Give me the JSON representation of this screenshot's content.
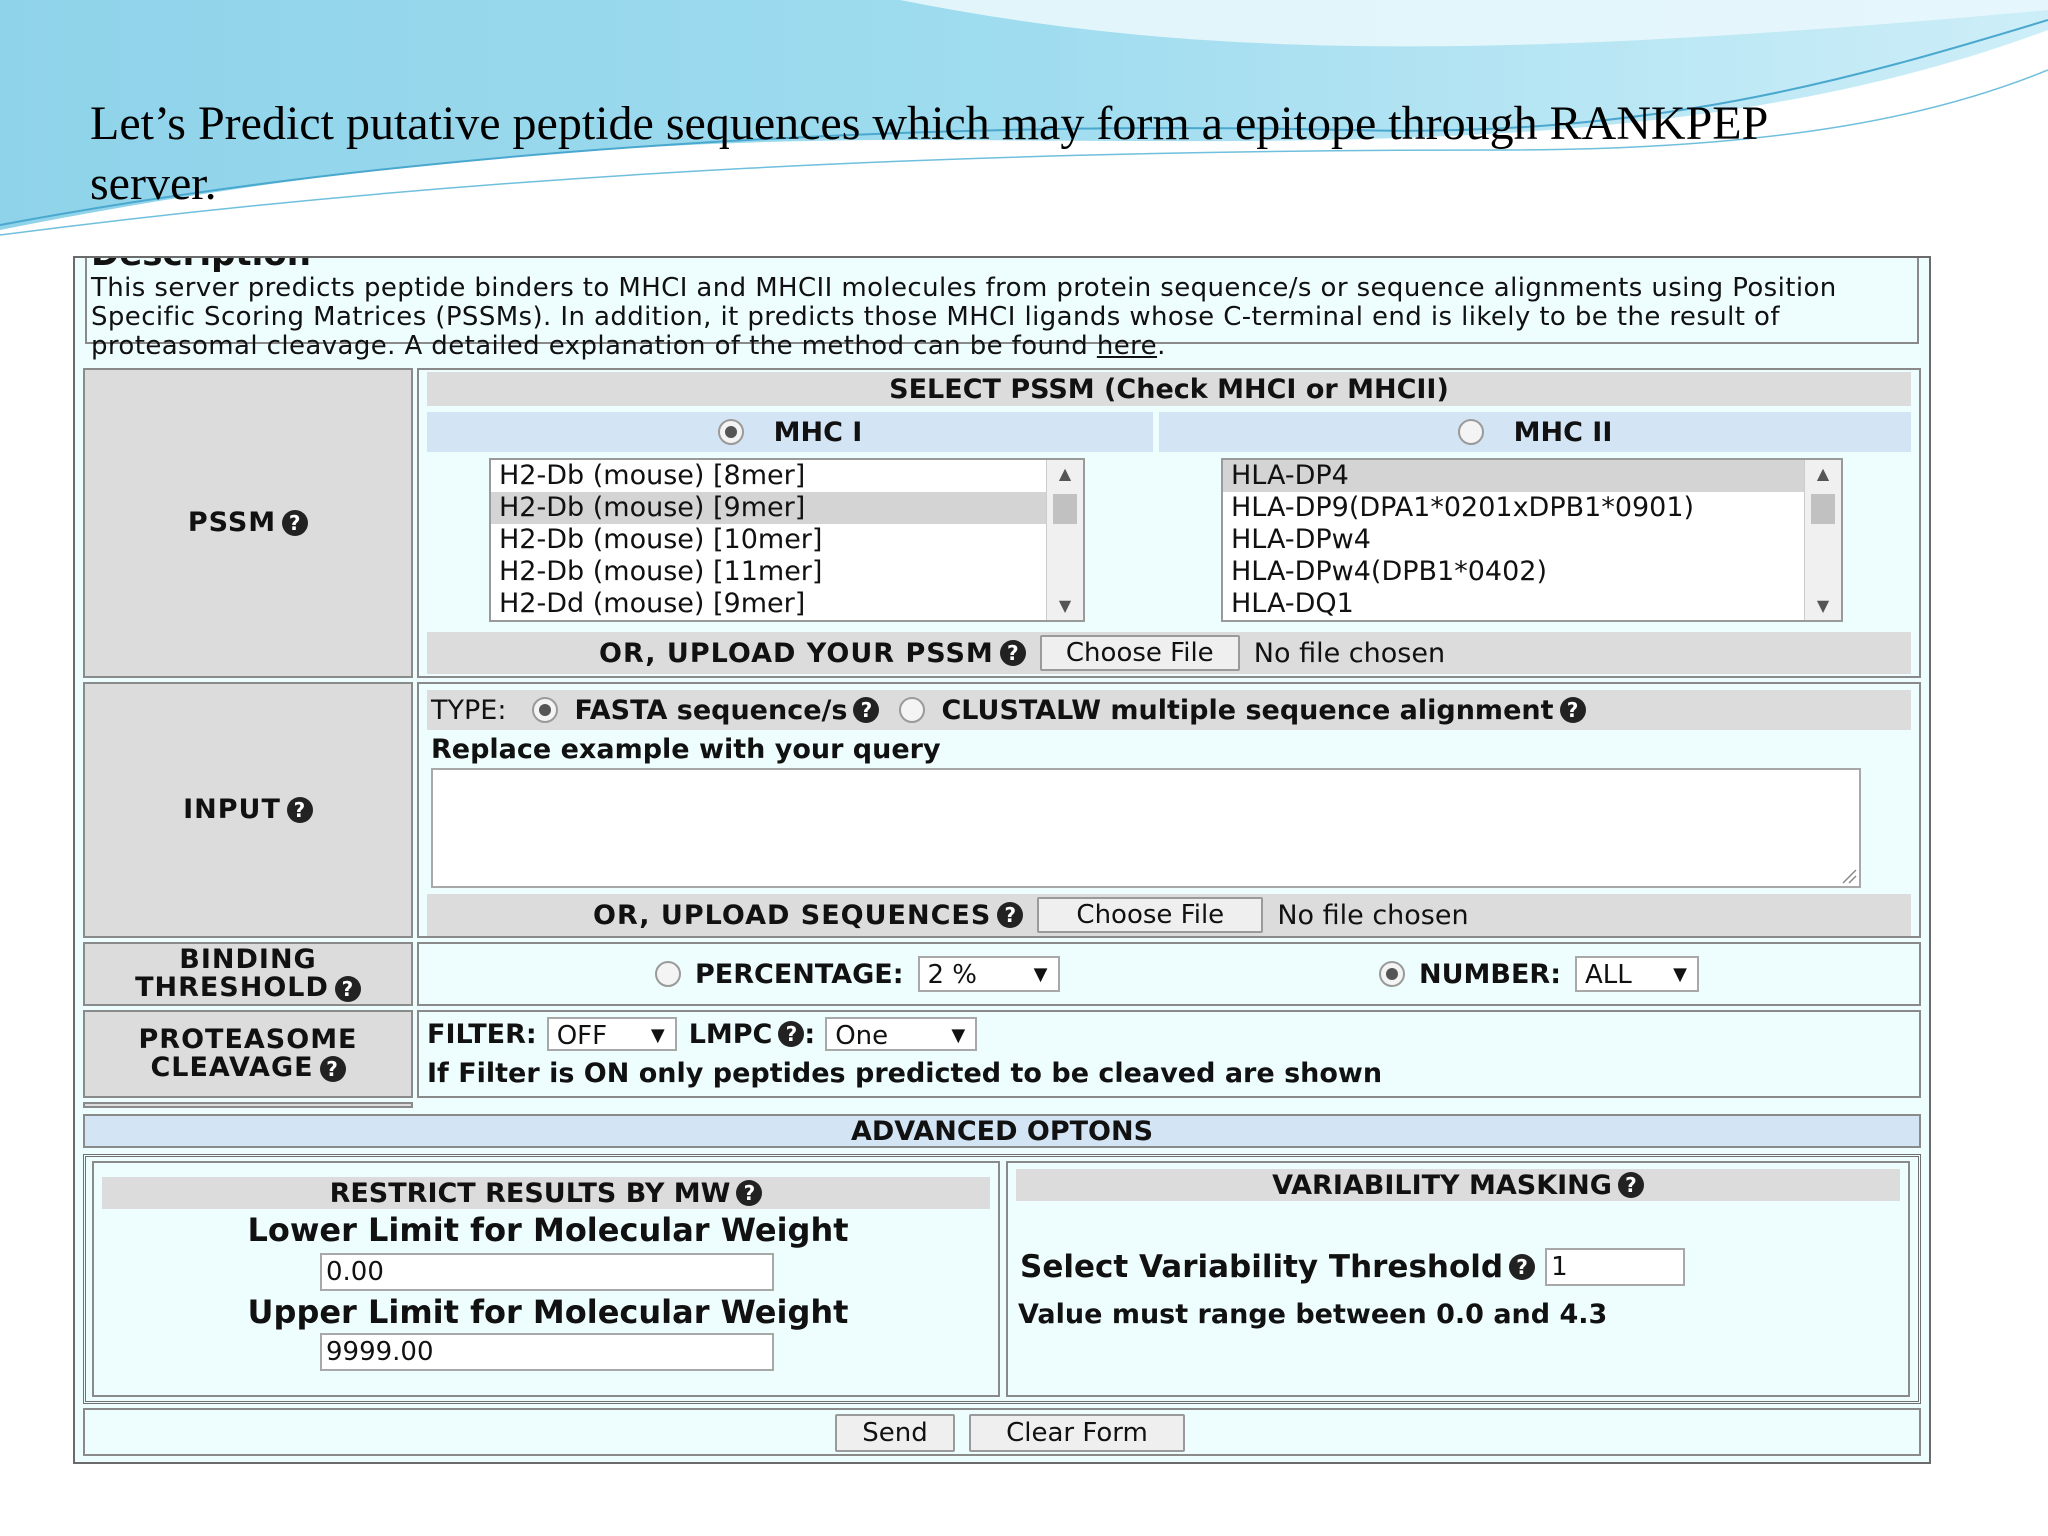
{
  "slide": {
    "title": "Let’s Predict putative peptide sequences which may form a epitope through RANKPEP server."
  },
  "description": {
    "heading": "Description",
    "text": "This server predicts peptide binders to MHCI and MHCII molecules from protein sequence/s or sequence alignments using Position Specific Scoring Matrices (PSSMs). In addition, it predicts those MHCI ligands whose C-terminal end is likely to be the result of proteasomal cleavage. A detailed explanation of the method can be found ",
    "link": "here",
    "end": "."
  },
  "pssm": {
    "label": "PSSM",
    "header": "SELECT PSSM (Check MHCI or MHCII)",
    "mhc1_label": "MHC I",
    "mhc2_label": "MHC II",
    "mhc1_options": [
      "H2-Db (mouse) [8mer]",
      "H2-Db (mouse) [9mer]",
      "H2-Db (mouse) [10mer]",
      "H2-Db (mouse) [11mer]",
      "H2-Dd (mouse) [9mer]"
    ],
    "mhc2_options": [
      "HLA-DP4",
      "HLA-DP9(DPA1*0201xDPB1*0901)",
      "HLA-DPw4",
      "HLA-DPw4(DPB1*0402)",
      "HLA-DQ1"
    ],
    "upload_label": "OR, UPLOAD YOUR PSSM",
    "choose_file": "Choose File",
    "no_file": "No file chosen"
  },
  "input": {
    "label": "INPUT",
    "type_label": "TYPE:",
    "fasta_label": "FASTA sequence/s",
    "clustalw_label": "CLUSTALW multiple sequence alignment",
    "replace_label": "Replace example with your query",
    "query_value": "",
    "upload_label": "OR, UPLOAD SEQUENCES",
    "choose_file": "Choose File",
    "no_file": "No file chosen"
  },
  "binding": {
    "label_line1": "BINDING",
    "label_line2": "THRESHOLD",
    "percentage_label": "PERCENTAGE:",
    "percentage_value": "2 %",
    "number_label": "NUMBER:",
    "number_value": "ALL"
  },
  "proteasome": {
    "label_line1": "PROTEASOME",
    "label_line2": "CLEAVAGE",
    "filter_label": "FILTER:",
    "filter_value": "OFF",
    "lmpc_label": "LMPC",
    "lmpc_value": "One",
    "note": "If Filter is ON only peptides predicted to be cleaved are shown"
  },
  "advanced": {
    "header": "ADVANCED OPTONS",
    "mw_header": "RESTRICT RESULTS BY MW",
    "lower_label": "Lower Limit for Molecular Weight",
    "lower_value": "0.00",
    "upper_label": "Upper Limit for Molecular Weight",
    "upper_value": "9999.00",
    "var_header": "VARIABILITY MASKING",
    "var_label": "Select Variability Threshold",
    "var_value": "1",
    "var_note": "Value must range between 0.0 and 4.3"
  },
  "actions": {
    "send": "Send",
    "clear": "Clear Form"
  },
  "colors": {
    "form_bg": "#eefdfd",
    "header_grey": "#dcdcdc",
    "header_blue": "#d3e4f5",
    "slide_wave": "#7cc9e6"
  },
  "icons": [
    "help-icon",
    "radio-selected",
    "radio-unselected",
    "dropdown-arrow-icon",
    "scroll-arrow-icon"
  ]
}
